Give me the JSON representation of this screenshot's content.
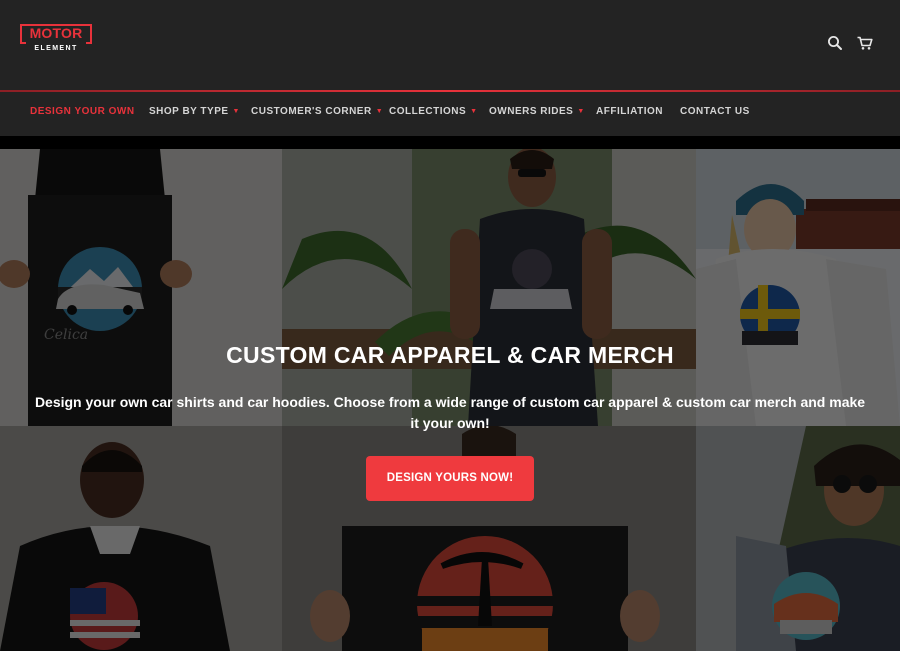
{
  "brand": {
    "logo_top": "MOTOR",
    "logo_bottom": "ELEMENT",
    "accent_color": "#e8323b",
    "header_bg": "#232323"
  },
  "header": {
    "icons": [
      "search-icon",
      "cart-icon"
    ]
  },
  "nav": {
    "items": [
      {
        "label": "DESIGN YOUR OWN",
        "active": true,
        "dropdown": false
      },
      {
        "label": "SHOP BY TYPE",
        "active": false,
        "dropdown": true
      },
      {
        "label": "CUSTOMER'S CORNER",
        "active": false,
        "dropdown": true
      },
      {
        "label": "COLLECTIONS",
        "active": false,
        "dropdown": true
      },
      {
        "label": "OWNERS RIDES",
        "active": false,
        "dropdown": true
      },
      {
        "label": "AFFILIATION",
        "active": false,
        "dropdown": false
      },
      {
        "label": "CONTACT US",
        "active": false,
        "dropdown": false
      }
    ]
  },
  "hero": {
    "title": "CUSTOM CAR APPAREL & CAR MERCH",
    "subtitle": "Design your own car shirts and car hoodies. Choose from a wide range of custom car apparel & custom car merch and make it your own!",
    "cta_label": "DESIGN YOURS NOW!",
    "cta_color": "#ef3a3e"
  }
}
